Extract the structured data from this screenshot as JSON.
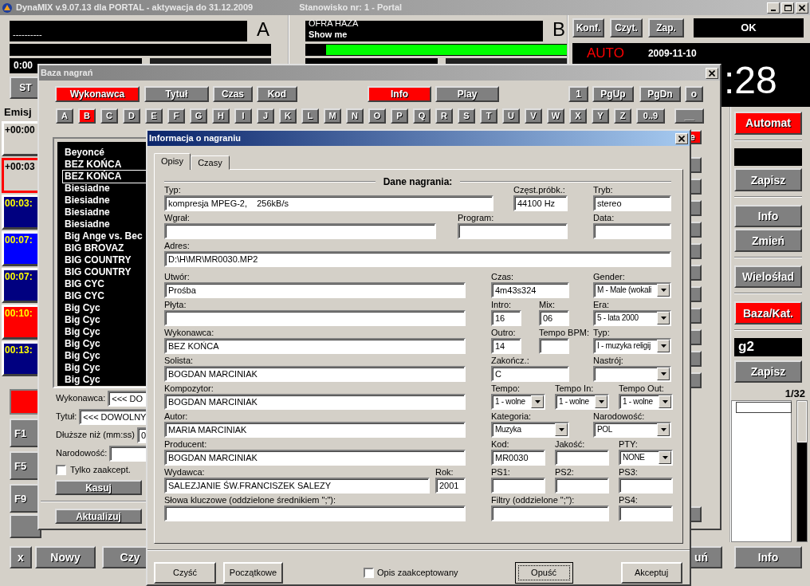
{
  "main_window": {
    "title": "DynaMIX v.9.07.13 dla PORTAL - aktywacja do 31.12.2009",
    "station": "Stanowisko nr: 1 - Portal"
  },
  "deck_a": {
    "title": "----------",
    "letter": "A",
    "time": "0:00",
    "button": "ST",
    "level": 0
  },
  "deck_b": {
    "artist": "OFRA HAZA",
    "title": "Show me",
    "letter": "B",
    "level": 0.92
  },
  "top_buttons": [
    "Konf.",
    "Czyt.",
    "Zap."
  ],
  "status": "OK",
  "clock": {
    "mode": "AUTO",
    "date": "2009-11-10",
    "time": ":28"
  },
  "playlist": {
    "header": "Emisj",
    "items": [
      {
        "time": "+00:00",
        "color": "#d4d0c8",
        "selected": false
      },
      {
        "time": "+00:03",
        "color": "#d4d0c8",
        "selected": true
      },
      {
        "time": "00:03:",
        "color": "#000080",
        "selected": false
      },
      {
        "time": "00:07:",
        "color": "#0000ff",
        "selected": false
      },
      {
        "time": "00:07:",
        "color": "#000080",
        "selected": false
      },
      {
        "time": "00:10:",
        "color": "#ff0000",
        "selected": false
      },
      {
        "time": "00:13:",
        "color": "#000080",
        "selected": false
      }
    ]
  },
  "function_keys": [
    "F1",
    "F5",
    "F9"
  ],
  "right_panel": [
    {
      "kind": "button",
      "label": "Automat",
      "active": true
    },
    {
      "kind": "display"
    },
    {
      "kind": "button",
      "label": "Zapisz",
      "active": false
    },
    {
      "kind": "button",
      "label": "Info",
      "active": false
    },
    {
      "kind": "button",
      "label": "Zmień",
      "active": false
    },
    {
      "kind": "button",
      "label": "Wielośład",
      "active": false
    },
    {
      "kind": "button",
      "label": "Baza/Kat.",
      "active": true
    },
    {
      "kind": "display",
      "value": "g2"
    },
    {
      "kind": "button",
      "label": "Zapisz",
      "active": false
    }
  ],
  "list_counter": "1/32",
  "bottom_buttons": [
    "x",
    "Nowy",
    "Czy"
  ],
  "bottom_right_buttons": [
    "uń",
    "Info"
  ],
  "database_window": {
    "title": "Baza nagrań",
    "sort_buttons": [
      {
        "label": "Wykonawca",
        "selected": true
      },
      {
        "label": "Tytuł",
        "selected": false
      },
      {
        "label": "Czas",
        "selected": false
      },
      {
        "label": "Kod",
        "selected": false
      }
    ],
    "view_buttons": [
      {
        "label": "Info",
        "on": true
      },
      {
        "label": "Play",
        "on": false
      }
    ],
    "page_buttons": [
      "1",
      "PgUp",
      "PgDn",
      "o"
    ],
    "letters": [
      {
        "label": "A",
        "selected": false
      },
      {
        "label": "B",
        "selected": true
      },
      {
        "label": "C",
        "selected": false
      },
      {
        "label": "D",
        "selected": false
      },
      {
        "label": "E",
        "selected": false
      },
      {
        "label": "F",
        "selected": false
      },
      {
        "label": "G",
        "selected": false
      },
      {
        "label": "H",
        "selected": false
      },
      {
        "label": "I",
        "selected": false
      },
      {
        "label": "J",
        "selected": false
      },
      {
        "label": "K",
        "selected": false
      },
      {
        "label": "L",
        "selected": false
      },
      {
        "label": "M",
        "selected": false
      },
      {
        "label": "N",
        "selected": false
      },
      {
        "label": "O",
        "selected": false
      },
      {
        "label": "P",
        "selected": false
      },
      {
        "label": "Q",
        "selected": false
      },
      {
        "label": "R",
        "selected": false
      },
      {
        "label": "S",
        "selected": false
      },
      {
        "label": "T",
        "selected": false
      },
      {
        "label": "U",
        "selected": false
      },
      {
        "label": "V",
        "selected": false
      },
      {
        "label": "W",
        "selected": false
      },
      {
        "label": "X",
        "selected": false
      },
      {
        "label": "Y",
        "selected": false
      },
      {
        "label": "Z",
        "selected": false
      },
      {
        "label": "0..9",
        "selected": false
      },
      {
        "label": "__",
        "selected": false
      }
    ],
    "side_button": {
      "label": "e",
      "active": true
    },
    "artists": [
      {
        "name": "Beyoncé",
        "selected": false
      },
      {
        "name": "BEZ KOŃCA",
        "selected": false
      },
      {
        "name": "BEZ KOŃCA",
        "selected": true
      },
      {
        "name": "Biesiadne",
        "selected": false
      },
      {
        "name": "Biesiadne",
        "selected": false
      },
      {
        "name": "Biesiadne",
        "selected": false
      },
      {
        "name": "Biesiadne",
        "selected": false
      },
      {
        "name": "Big Ange vs. Bec",
        "selected": false
      },
      {
        "name": "BIG BROVAZ",
        "selected": false
      },
      {
        "name": "BIG COUNTRY",
        "selected": false
      },
      {
        "name": "BIG COUNTRY",
        "selected": false
      },
      {
        "name": "BIG CYC",
        "selected": false
      },
      {
        "name": "BIG CYC",
        "selected": false
      },
      {
        "name": "Big Cyc",
        "selected": false
      },
      {
        "name": "Big Cyc",
        "selected": false
      },
      {
        "name": "Big Cyc",
        "selected": false
      },
      {
        "name": "Big Cyc",
        "selected": false
      },
      {
        "name": "Big Cyc",
        "selected": false
      },
      {
        "name": "Big Cyc",
        "selected": false
      },
      {
        "name": "Big Cyc",
        "selected": false
      }
    ],
    "filters": [
      {
        "label": "Wykonawca:",
        "value": "<<< DO"
      },
      {
        "label": "Tytuł:",
        "value": "<<< DOWOLNY"
      },
      {
        "label": "Dłuższe niż (mm:ss)",
        "value": "0"
      },
      {
        "label": "Narodowość:"
      }
    ],
    "checkboxes": [
      {
        "label": "Tylko zaakcept.",
        "checked": false
      }
    ],
    "buttons": [
      "Kasuj",
      "Aktualizuj"
    ]
  },
  "info_dialog": {
    "title": "Informacja o nagraniu",
    "tabs": [
      {
        "label": "Opisy",
        "selected": true
      },
      {
        "label": "Czasy",
        "selected": false
      }
    ],
    "section": "Dane nagrania:",
    "top_rows": [
      [
        {
          "label": "Typ:",
          "value": "kompresja MPEG-2,    256kB/s",
          "kind": "text"
        },
        {
          "label": "Częst.próbk.:",
          "value": "44100 Hz",
          "kind": "text"
        },
        {
          "label": "Tryb:",
          "value": "stereo",
          "kind": "text"
        }
      ],
      [
        {
          "label": "Wgrał:",
          "kind": "text"
        },
        {
          "label": "Program:",
          "kind": "text"
        },
        {
          "label": "Data:",
          "kind": "text"
        }
      ],
      [
        {
          "label": "Adres:",
          "value": "D:\\H\\MR\\MR0030.MP2",
          "kind": "text"
        }
      ]
    ],
    "left_rows": [
      [
        {
          "label": "Utwór:",
          "value": "Prośba",
          "kind": "text"
        }
      ],
      [
        {
          "label": "Płyta:",
          "kind": "text"
        }
      ],
      [
        {
          "label": "Wykonawca:",
          "value": "BEZ KOŃCA",
          "kind": "text"
        }
      ],
      [
        {
          "label": "Solista:",
          "value": "BOGDAN MARCINIAK",
          "kind": "text"
        }
      ],
      [
        {
          "label": "Kompozytor:",
          "value": "BOGDAN MARCINIAK",
          "kind": "text"
        }
      ],
      [
        {
          "label": "Autor:",
          "value": "MARIA MARCINIAK",
          "kind": "text"
        }
      ],
      [
        {
          "label": "Producent:",
          "value": "BOGDAN MARCINIAK",
          "kind": "text"
        }
      ],
      [
        {
          "label": "Wydawca:",
          "value": "SALEZJANIE ŚW.FRANCISZEK SALEZY",
          "kind": "text"
        },
        {
          "label": "Rok:",
          "value": "2001",
          "kind": "text"
        }
      ],
      [
        {
          "label": "Słowa kluczowe (oddzielone średnikiem \";\"):",
          "kind": "text"
        }
      ]
    ],
    "right_rows": [
      [
        {
          "label": "Czas:",
          "value": "4m43s324",
          "kind": "text"
        },
        {
          "label": "Gender:",
          "value": "M - Male (wokali",
          "kind": "select"
        }
      ],
      [
        {
          "label": "Intro:",
          "value": "16",
          "kind": "text"
        },
        {
          "label": "Mix:",
          "value": "06",
          "kind": "text"
        },
        {
          "label": "Era:",
          "value": "5 - lata 2000",
          "kind": "select"
        }
      ],
      [
        {
          "label": "Outro:",
          "value": "14",
          "kind": "text"
        },
        {
          "label": "Tempo BPM:",
          "kind": "text"
        },
        {
          "label": "Typ:",
          "value": "I - muzyka religij",
          "kind": "select"
        }
      ],
      [
        {
          "label": "Zakończ.:",
          "value": "C",
          "kind": "text"
        },
        {
          "label": "Nastrój:",
          "kind": "select"
        }
      ],
      [
        {
          "label": "Tempo:",
          "value": "1 - wolne",
          "kind": "select"
        },
        {
          "label": "Tempo In:",
          "value": "1 - wolne",
          "kind": "select"
        },
        {
          "label": "Tempo Out:",
          "value": "1 - wolne",
          "kind": "select"
        }
      ],
      [
        {
          "label": "Kategoria:",
          "value": "Muzyka",
          "kind": "select"
        },
        {
          "label": "Narodowość:",
          "value": "POL",
          "kind": "select"
        }
      ],
      [
        {
          "label": "Kod:",
          "value": "MR0030",
          "kind": "text"
        },
        {
          "label": "Jakość:",
          "kind": "text"
        },
        {
          "label": "PTY:",
          "value": "NONE",
          "kind": "select"
        }
      ],
      [
        {
          "label": "PS1:",
          "kind": "text"
        },
        {
          "label": "PS2:",
          "kind": "text"
        },
        {
          "label": "PS3:",
          "kind": "text"
        }
      ],
      [
        {
          "label": "Filtry (oddzielone \";\"):",
          "kind": "text"
        },
        {
          "label": "PS4:",
          "kind": "text"
        }
      ]
    ],
    "footer_left": [
      {
        "label": "Czyść",
        "focused": false
      },
      {
        "label": "Początkowe",
        "focused": false
      }
    ],
    "accepted_checkbox": {
      "label": "Opis zaakceptowany",
      "checked": false
    },
    "footer_right": [
      {
        "label": "Opuść",
        "focused": true
      },
      {
        "label": "Akceptuj",
        "focused": false
      }
    ]
  }
}
